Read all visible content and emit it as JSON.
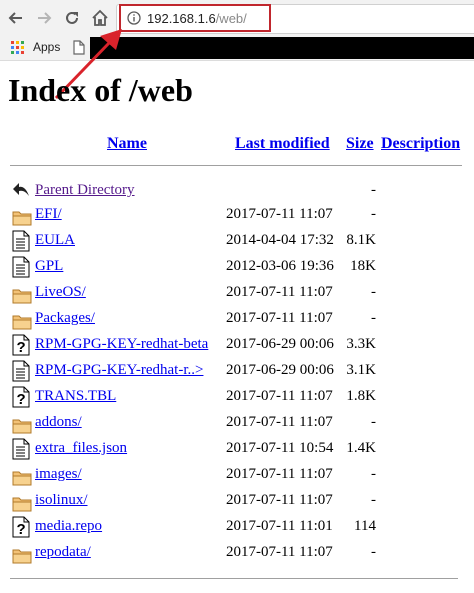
{
  "browser": {
    "url_host": "192.168.1.6",
    "url_path": "/web/",
    "bookmarks_apps_label": "Apps"
  },
  "page": {
    "title": "Index of /web",
    "columns": {
      "name": "Name",
      "last_modified": "Last modified",
      "size": "Size",
      "description": "Description"
    },
    "parent": {
      "name": "Parent Directory",
      "size": "-"
    },
    "entries": [
      {
        "name": "EFI/",
        "modified": "2017-07-11 11:07",
        "size": "-",
        "icon": "folder-icon"
      },
      {
        "name": "EULA",
        "modified": "2014-04-04 17:32",
        "size": "8.1K",
        "icon": "text-file-icon"
      },
      {
        "name": "GPL",
        "modified": "2012-03-06 19:36",
        "size": "18K",
        "icon": "text-file-icon"
      },
      {
        "name": "LiveOS/",
        "modified": "2017-07-11 11:07",
        "size": "-",
        "icon": "folder-icon"
      },
      {
        "name": "Packages/",
        "modified": "2017-07-11 11:07",
        "size": "-",
        "icon": "folder-icon"
      },
      {
        "name": "RPM-GPG-KEY-redhat-beta",
        "modified": "2017-06-29 00:06",
        "size": "3.3K",
        "icon": "unknown-file-icon"
      },
      {
        "name": "RPM-GPG-KEY-redhat-r..>",
        "modified": "2017-06-29 00:06",
        "size": "3.1K",
        "icon": "text-file-icon"
      },
      {
        "name": "TRANS.TBL",
        "modified": "2017-07-11 11:07",
        "size": "1.8K",
        "icon": "unknown-file-icon"
      },
      {
        "name": "addons/",
        "modified": "2017-07-11 11:07",
        "size": "-",
        "icon": "folder-icon"
      },
      {
        "name": "extra_files.json",
        "modified": "2017-07-11 10:54",
        "size": "1.4K",
        "icon": "text-file-icon"
      },
      {
        "name": "images/",
        "modified": "2017-07-11 11:07",
        "size": "-",
        "icon": "folder-icon"
      },
      {
        "name": "isolinux/",
        "modified": "2017-07-11 11:07",
        "size": "-",
        "icon": "folder-icon"
      },
      {
        "name": "media.repo",
        "modified": "2017-07-11 11:01",
        "size": "114",
        "icon": "unknown-file-icon"
      },
      {
        "name": "repodata/",
        "modified": "2017-07-11 11:07",
        "size": "-",
        "icon": "folder-icon"
      }
    ]
  },
  "annotation": {
    "color": "#d9232b"
  }
}
